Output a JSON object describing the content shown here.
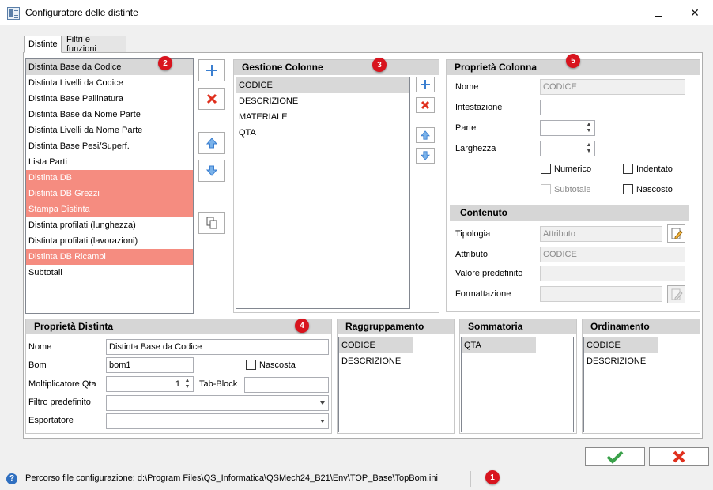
{
  "window": {
    "title": "Configuratore delle distinte"
  },
  "tabs": [
    {
      "label": "Distinte"
    },
    {
      "label": "Filtri e funzioni"
    }
  ],
  "badges": [
    "1",
    "2",
    "3",
    "4",
    "5"
  ],
  "distinte_list": [
    {
      "label": "Distinta Base da Codice",
      "state": "selected"
    },
    {
      "label": "Distinta Livelli da Codice",
      "state": ""
    },
    {
      "label": "Distinta Base Pallinatura",
      "state": ""
    },
    {
      "label": "Distinta Base da Nome Parte",
      "state": ""
    },
    {
      "label": "Distinta Livelli da Nome Parte",
      "state": ""
    },
    {
      "label": "Distinta Base Pesi/Superf.",
      "state": ""
    },
    {
      "label": "Lista Parti",
      "state": ""
    },
    {
      "label": "Distinta DB",
      "state": "pink"
    },
    {
      "label": "Distinta DB Grezzi",
      "state": "pink"
    },
    {
      "label": "Stampa Distinta",
      "state": "pink"
    },
    {
      "label": "Distinta profilati (lunghezza)",
      "state": ""
    },
    {
      "label": "Distinta profilati (lavorazioni)",
      "state": ""
    },
    {
      "label": "Distinta DB Ricambi",
      "state": "pink"
    },
    {
      "label": "Subtotali",
      "state": ""
    }
  ],
  "gestione_colonne": {
    "header": "Gestione Colonne",
    "items": [
      "CODICE",
      "DESCRIZIONE",
      "MATERIALE",
      "QTA"
    ]
  },
  "proprieta_colonna": {
    "header": "Proprietà Colonna",
    "nome_label": "Nome",
    "nome_value": "CODICE",
    "intestazione_label": "Intestazione",
    "intestazione_value": "",
    "parte_label": "Parte",
    "parte_value": "",
    "larghezza_label": "Larghezza",
    "larghezza_value": "",
    "numerico_label": "Numerico",
    "indentato_label": "Indentato",
    "subtotale_label": "Subtotale",
    "nascosto_label": "Nascosto",
    "contenuto_header": "Contenuto",
    "tipologia_label": "Tipologia",
    "tipologia_value": "Attributo",
    "attributo_label": "Attributo",
    "attributo_value": "CODICE",
    "valore_label": "Valore predefinito",
    "valore_value": "",
    "formattazione_label": "Formattazione",
    "formattazione_value": ""
  },
  "proprieta_distinta": {
    "header": "Proprietà Distinta",
    "nome_label": "Nome",
    "nome_value": "Distinta Base da Codice",
    "bom_label": "Bom",
    "bom_value": "bom1",
    "nascosta_label": "Nascosta",
    "moltiplicatore_label": "Moltiplicatore Qta",
    "moltiplicatore_value": "1",
    "tabblock_label": "Tab-Block",
    "tabblock_value": "",
    "filtro_label": "Filtro predefinito",
    "filtro_value": "",
    "esportatore_label": "Esportatore",
    "esportatore_value": ""
  },
  "raggruppamento": {
    "header": "Raggruppamento",
    "items": [
      "CODICE",
      "DESCRIZIONE"
    ]
  },
  "sommatoria": {
    "header": "Sommatoria",
    "items": [
      "QTA"
    ]
  },
  "ordinamento": {
    "header": "Ordinamento",
    "items": [
      "CODICE",
      "DESCRIZIONE"
    ]
  },
  "status": {
    "text": "Percorso file configurazione: d:\\Program Files\\QS_Informatica\\QSMech24_B21\\Env\\TOP_Base\\TopBom.ini"
  },
  "colors": {
    "pink_row": "#f58c80",
    "badge": "#d8141e",
    "ok_green": "#3aa14a",
    "cancel_red": "#e0301e",
    "arrow_blue": "#3b7fd0"
  }
}
